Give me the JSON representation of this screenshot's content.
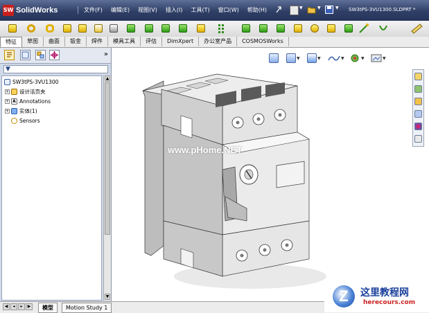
{
  "app": {
    "logo_mark": "SW",
    "name": "SolidWorks",
    "file_name": "SW3tPS-3VU1300.SLDPRT *"
  },
  "menu": [
    {
      "label": "文件(F)"
    },
    {
      "label": "编辑(E)"
    },
    {
      "label": "视图(V)"
    },
    {
      "label": "插入(I)"
    },
    {
      "label": "工具(T)"
    },
    {
      "label": "窗口(W)"
    },
    {
      "label": "帮助(H)"
    }
  ],
  "tabs": [
    {
      "label": "特征"
    },
    {
      "label": "草图"
    },
    {
      "label": "曲面"
    },
    {
      "label": "钣金"
    },
    {
      "label": "焊件"
    },
    {
      "label": "模具工具"
    },
    {
      "label": "评估"
    },
    {
      "label": "DimXpert"
    },
    {
      "label": "办公室产品"
    },
    {
      "label": "COSMOSWorks"
    }
  ],
  "panel": {
    "tree": [
      {
        "label": "SW3tPS-3VU1300"
      },
      {
        "label": "设计活页夹"
      },
      {
        "label": "Annotations"
      },
      {
        "label": "实体(1)"
      },
      {
        "label": "Sensors"
      }
    ]
  },
  "viewport": {
    "watermark": "www.pHome.NET"
  },
  "bottom_tabs": [
    {
      "label": "模型"
    },
    {
      "label": "Motion Study 1"
    }
  ],
  "site_logo": {
    "mark": "Z",
    "name_cn": "这里教程网",
    "url": "herecours.com"
  },
  "icons": {
    "toolbar": [
      "extrude-boss-icon",
      "revolve-icon",
      "sweep-icon",
      "loft-icon",
      "boundary-icon",
      "cut-icon",
      "fillet-icon",
      "chamfer-icon",
      "shell-icon",
      "rib-icon",
      "draft-icon",
      "hole-wizard-icon",
      "linear-pattern-icon",
      "mirror-icon",
      "dome-icon",
      "reference-geometry-icon",
      "curves-icon",
      "instant3d-icon"
    ],
    "view": [
      "zoom-fit-icon",
      "section-view-icon",
      "view-orientation-icon",
      "display-style-icon",
      "hide-show-icon",
      "scene-icon"
    ],
    "taskpane": [
      "resources-icon",
      "design-library-icon",
      "file-explorer-icon",
      "view-palette-icon",
      "appearances-icon",
      "custom-properties-icon"
    ]
  },
  "colors": {
    "title_bar": "#2f3f66",
    "panel_bg": "#cfd9ea",
    "part_body": "#d9d9d9"
  }
}
